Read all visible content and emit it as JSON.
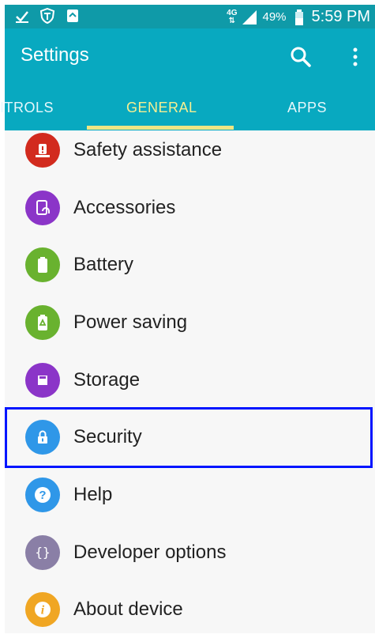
{
  "status_bar": {
    "network": "4G",
    "battery_percent": "49%",
    "time": "5:59 PM"
  },
  "app_bar": {
    "title": "Settings",
    "search_icon": "search-icon",
    "more_icon": "more-vert-icon"
  },
  "tabs": [
    {
      "label": "CONTROLS",
      "visible_text": "ITROLS",
      "selected": false
    },
    {
      "label": "GENERAL",
      "selected": true
    },
    {
      "label": "APPS",
      "selected": false
    }
  ],
  "settings_items": [
    {
      "label": "Safety assistance",
      "icon": "warning-icon",
      "color": "#d22b1e"
    },
    {
      "label": "Accessories",
      "icon": "accessory-icon",
      "color": "#8b35c8"
    },
    {
      "label": "Battery",
      "icon": "battery-icon",
      "color": "#69b22f"
    },
    {
      "label": "Power saving",
      "icon": "power-saving-icon",
      "color": "#69b22f"
    },
    {
      "label": "Storage",
      "icon": "storage-icon",
      "color": "#8b35c8"
    },
    {
      "label": "Security",
      "icon": "lock-icon",
      "color": "#2f97e8"
    },
    {
      "label": "Help",
      "icon": "help-icon",
      "color": "#2f97e8"
    },
    {
      "label": "Developer options",
      "icon": "braces-icon",
      "color": "#8a7fa6"
    },
    {
      "label": "About device",
      "icon": "info-icon",
      "color": "#f0a623"
    }
  ],
  "highlighted_item": "Security"
}
